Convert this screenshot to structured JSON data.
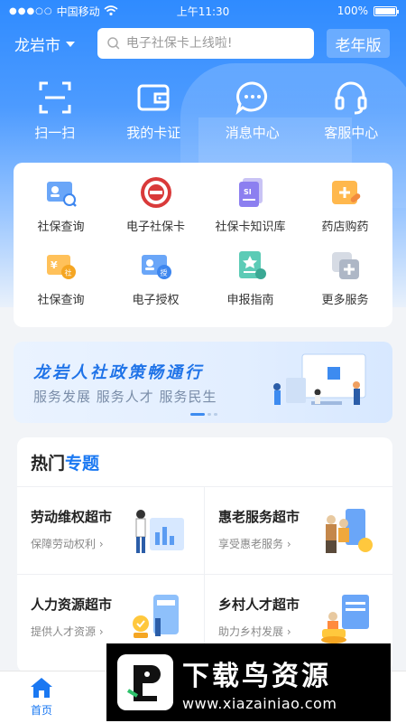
{
  "status_bar": {
    "carrier": "中国移动",
    "time": "上午11:30",
    "battery": "100%"
  },
  "header": {
    "city": "龙岩市",
    "search_placeholder": "电子社保卡上线啦!",
    "elder_mode": "老年版"
  },
  "quick_actions": [
    {
      "label": "扫一扫",
      "icon": "scan-icon"
    },
    {
      "label": "我的卡证",
      "icon": "wallet-icon"
    },
    {
      "label": "消息中心",
      "icon": "message-icon"
    },
    {
      "label": "客服中心",
      "icon": "headset-icon"
    }
  ],
  "services": [
    {
      "label": "社保查询",
      "icon": "id-card-search-icon"
    },
    {
      "label": "电子社保卡",
      "icon": "social-security-badge-icon"
    },
    {
      "label": "社保卡知识库",
      "icon": "si-document-icon"
    },
    {
      "label": "药店购药",
      "icon": "pharmacy-icon"
    },
    {
      "label": "社保查询",
      "icon": "yuan-social-icon"
    },
    {
      "label": "电子授权",
      "icon": "authorize-card-icon"
    },
    {
      "label": "申报指南",
      "icon": "guide-star-icon"
    },
    {
      "label": "更多服务",
      "icon": "more-services-icon"
    }
  ],
  "banner": {
    "title": "龙岩人社政策畅通行",
    "subtitle": "服务发展 服务人才 服务民生"
  },
  "topics": {
    "heading_a": "热门",
    "heading_b": "专题",
    "items": [
      {
        "title": "劳动维权超市",
        "subtitle": "保障劳动权利 ›"
      },
      {
        "title": "惠老服务超市",
        "subtitle": "享受惠老服务 ›"
      },
      {
        "title": "人力资源超市",
        "subtitle": "提供人才资源 ›"
      },
      {
        "title": "乡村人才超市",
        "subtitle": "助力乡村发展 ›"
      }
    ]
  },
  "tabbar": {
    "home": "首页"
  },
  "watermark": {
    "main": "下载鸟资源",
    "url": "www.xiazainiao.com"
  },
  "colors": {
    "primary": "#1a78f2",
    "header_top": "#2f8bff",
    "background": "#f2f4f7"
  }
}
